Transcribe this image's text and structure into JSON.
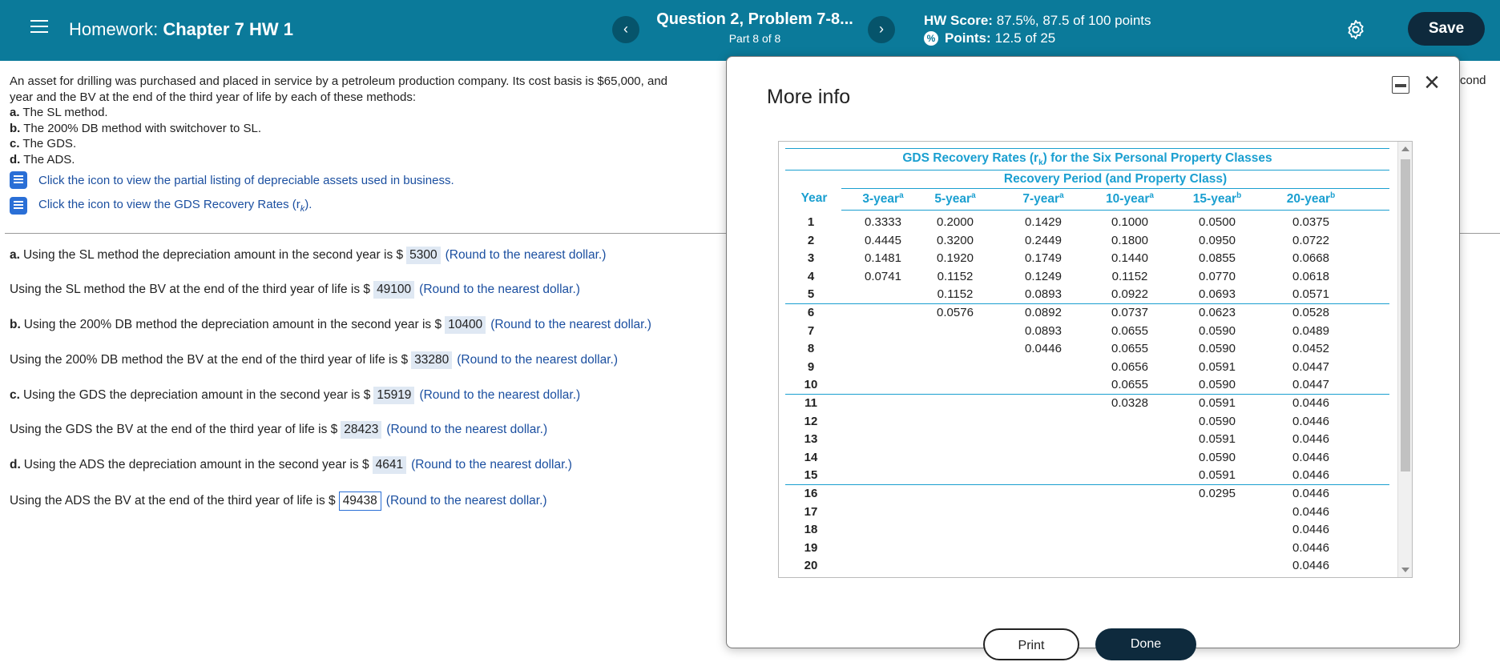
{
  "header": {
    "hw_prefix": "Homework: ",
    "hw_chapter": "Chapter 7 HW 1",
    "question_title": "Question 2, Problem 7-8...",
    "part": "Part 8 of 8",
    "hw_score_label": "HW Score:",
    "hw_score_value": "87.5%, 87.5 of 100 points",
    "points_label": "Points:",
    "points_value": "12.5 of 25",
    "save_label": "Save",
    "prev_glyph": "‹",
    "next_glyph": "›"
  },
  "problem": {
    "line1": "An asset for drilling was purchased and placed in service by a petroleum production company. Its cost basis is $65,000, and",
    "line2": "year and the BV at the end of the third year of life by each of these methods:",
    "items": [
      {
        "letter": "a.",
        "text": "The SL method."
      },
      {
        "letter": "b.",
        "text": "The 200% DB method with switchover to SL."
      },
      {
        "letter": "c.",
        "text": "The GDS."
      },
      {
        "letter": "d.",
        "text": "The ADS."
      }
    ],
    "cond_text": "cond",
    "link1": "Click the icon to view the partial listing of depreciable assets used in business.",
    "link2": "Click the icon to view the GDS Recovery Rates (r",
    "link2_sub": "k",
    "link2_end": ")."
  },
  "answers": [
    {
      "prefix": "a.",
      "text": "Using the SL method the depreciation amount in the second year is $",
      "value": "5300",
      "hint": "(Round to the nearest dollar.)"
    },
    {
      "prefix": "",
      "text": "Using the SL method the BV at the end of the third year of life is $",
      "value": "49100",
      "hint": "(Round to the nearest dollar.)"
    },
    {
      "prefix": "b.",
      "text": "Using the 200% DB method the depreciation amount in the second year is $",
      "value": "10400",
      "hint": "(Round to the nearest dollar.)"
    },
    {
      "prefix": "",
      "text": "Using the 200% DB method the BV at the end of the third year of life is $",
      "value": "33280",
      "hint": "(Round to the nearest dollar.)"
    },
    {
      "prefix": "c.",
      "text": "Using the GDS the depreciation amount in the second year is $",
      "value": "15919",
      "hint": "(Round to the nearest dollar.)"
    },
    {
      "prefix": "",
      "text": "Using the GDS the BV at the end of the third year of life is $",
      "value": "28423",
      "hint": "(Round to the nearest dollar.)"
    },
    {
      "prefix": "d.",
      "text": "Using the ADS the depreciation amount in the second year is $",
      "value": "4641",
      "hint": "(Round to the nearest dollar.)"
    },
    {
      "prefix": "",
      "text": "Using the ADS the BV at the end of the third year of life is $",
      "value": "49438",
      "hint": "(Round to the nearest dollar.)"
    }
  ],
  "modal": {
    "title": "More info",
    "table_title_pre": "GDS Recovery Rates (r",
    "table_title_sub": "k",
    "table_title_post": ") for the Six Personal Property Classes",
    "recovery_period": "Recovery Period (and Property Class)",
    "year_header": "Year",
    "columns": [
      {
        "label": "3-year",
        "sup": "a"
      },
      {
        "label": "5-year",
        "sup": "a"
      },
      {
        "label": "7-year",
        "sup": "a"
      },
      {
        "label": "10-year",
        "sup": "a"
      },
      {
        "label": "15-year",
        "sup": "b"
      },
      {
        "label": "20-year",
        "sup": "b"
      }
    ],
    "rows": [
      [
        "1",
        "0.3333",
        "0.2000",
        "0.1429",
        "0.1000",
        "0.0500",
        "0.0375"
      ],
      [
        "2",
        "0.4445",
        "0.3200",
        "0.2449",
        "0.1800",
        "0.0950",
        "0.0722"
      ],
      [
        "3",
        "0.1481",
        "0.1920",
        "0.1749",
        "0.1440",
        "0.0855",
        "0.0668"
      ],
      [
        "4",
        "0.0741",
        "0.1152",
        "0.1249",
        "0.1152",
        "0.0770",
        "0.0618"
      ],
      [
        "5",
        "",
        "0.1152",
        "0.0893",
        "0.0922",
        "0.0693",
        "0.0571"
      ],
      [
        "6",
        "",
        "0.0576",
        "0.0892",
        "0.0737",
        "0.0623",
        "0.0528"
      ],
      [
        "7",
        "",
        "",
        "0.0893",
        "0.0655",
        "0.0590",
        "0.0489"
      ],
      [
        "8",
        "",
        "",
        "0.0446",
        "0.0655",
        "0.0590",
        "0.0452"
      ],
      [
        "9",
        "",
        "",
        "",
        "0.0656",
        "0.0591",
        "0.0447"
      ],
      [
        "10",
        "",
        "",
        "",
        "0.0655",
        "0.0590",
        "0.0447"
      ],
      [
        "11",
        "",
        "",
        "",
        "0.0328",
        "0.0591",
        "0.0446"
      ],
      [
        "12",
        "",
        "",
        "",
        "",
        "0.0590",
        "0.0446"
      ],
      [
        "13",
        "",
        "",
        "",
        "",
        "0.0591",
        "0.0446"
      ],
      [
        "14",
        "",
        "",
        "",
        "",
        "0.0590",
        "0.0446"
      ],
      [
        "15",
        "",
        "",
        "",
        "",
        "0.0591",
        "0.0446"
      ],
      [
        "16",
        "",
        "",
        "",
        "",
        "0.0295",
        "0.0446"
      ],
      [
        "17",
        "",
        "",
        "",
        "",
        "",
        "0.0446"
      ],
      [
        "18",
        "",
        "",
        "",
        "",
        "",
        "0.0446"
      ],
      [
        "19",
        "",
        "",
        "",
        "",
        "",
        "0.0446"
      ],
      [
        "20",
        "",
        "",
        "",
        "",
        "",
        "0.0446"
      ]
    ],
    "print_label": "Print",
    "done_label": "Done"
  },
  "colors": {
    "header_bg": "#0b7a9a",
    "accent_blue": "#1a9fd0",
    "link_blue": "#1b4fa0",
    "save_bg": "#0e2a3d"
  }
}
